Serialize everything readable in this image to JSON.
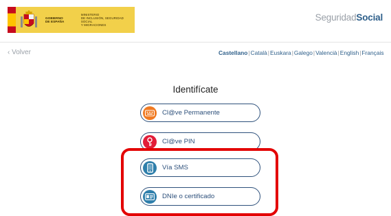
{
  "header": {
    "gov_line1": "GOBIERNO",
    "gov_line2": "DE ESPAÑA",
    "ministry_line1": "MINISTERIO",
    "ministry_line2": "DE INCLUSIÓN, SEGURIDAD SOCIAL",
    "ministry_line3": "Y MIGRACIONES",
    "brand_light": "Seguridad",
    "brand_bold": "Social"
  },
  "nav": {
    "back_label": "‹ Volver",
    "languages": [
      {
        "label": "Castellano",
        "active": true
      },
      {
        "label": "Català"
      },
      {
        "label": "Euskara"
      },
      {
        "label": "Galego"
      },
      {
        "label": "Valencià"
      },
      {
        "label": "English"
      },
      {
        "label": "Français"
      }
    ],
    "separator": "|"
  },
  "main": {
    "title": "Identifícate",
    "options": [
      {
        "label": "Cl@ve Permanente",
        "icon": "keyboard-icon",
        "color": "#f07a22"
      },
      {
        "label": "Cl@ve PIN",
        "icon": "key-icon",
        "color": "#e21d38"
      },
      {
        "label": "Vía SMS",
        "icon": "mobile-phone-icon",
        "color": "#2f7fab"
      },
      {
        "label": "DNIe o certificado",
        "icon": "id-card-icon",
        "color": "#2f7fab"
      }
    ]
  },
  "colors": {
    "accent": "#2c4f7a",
    "highlight": "#e30000",
    "gov_banner": "#f2d04a"
  }
}
